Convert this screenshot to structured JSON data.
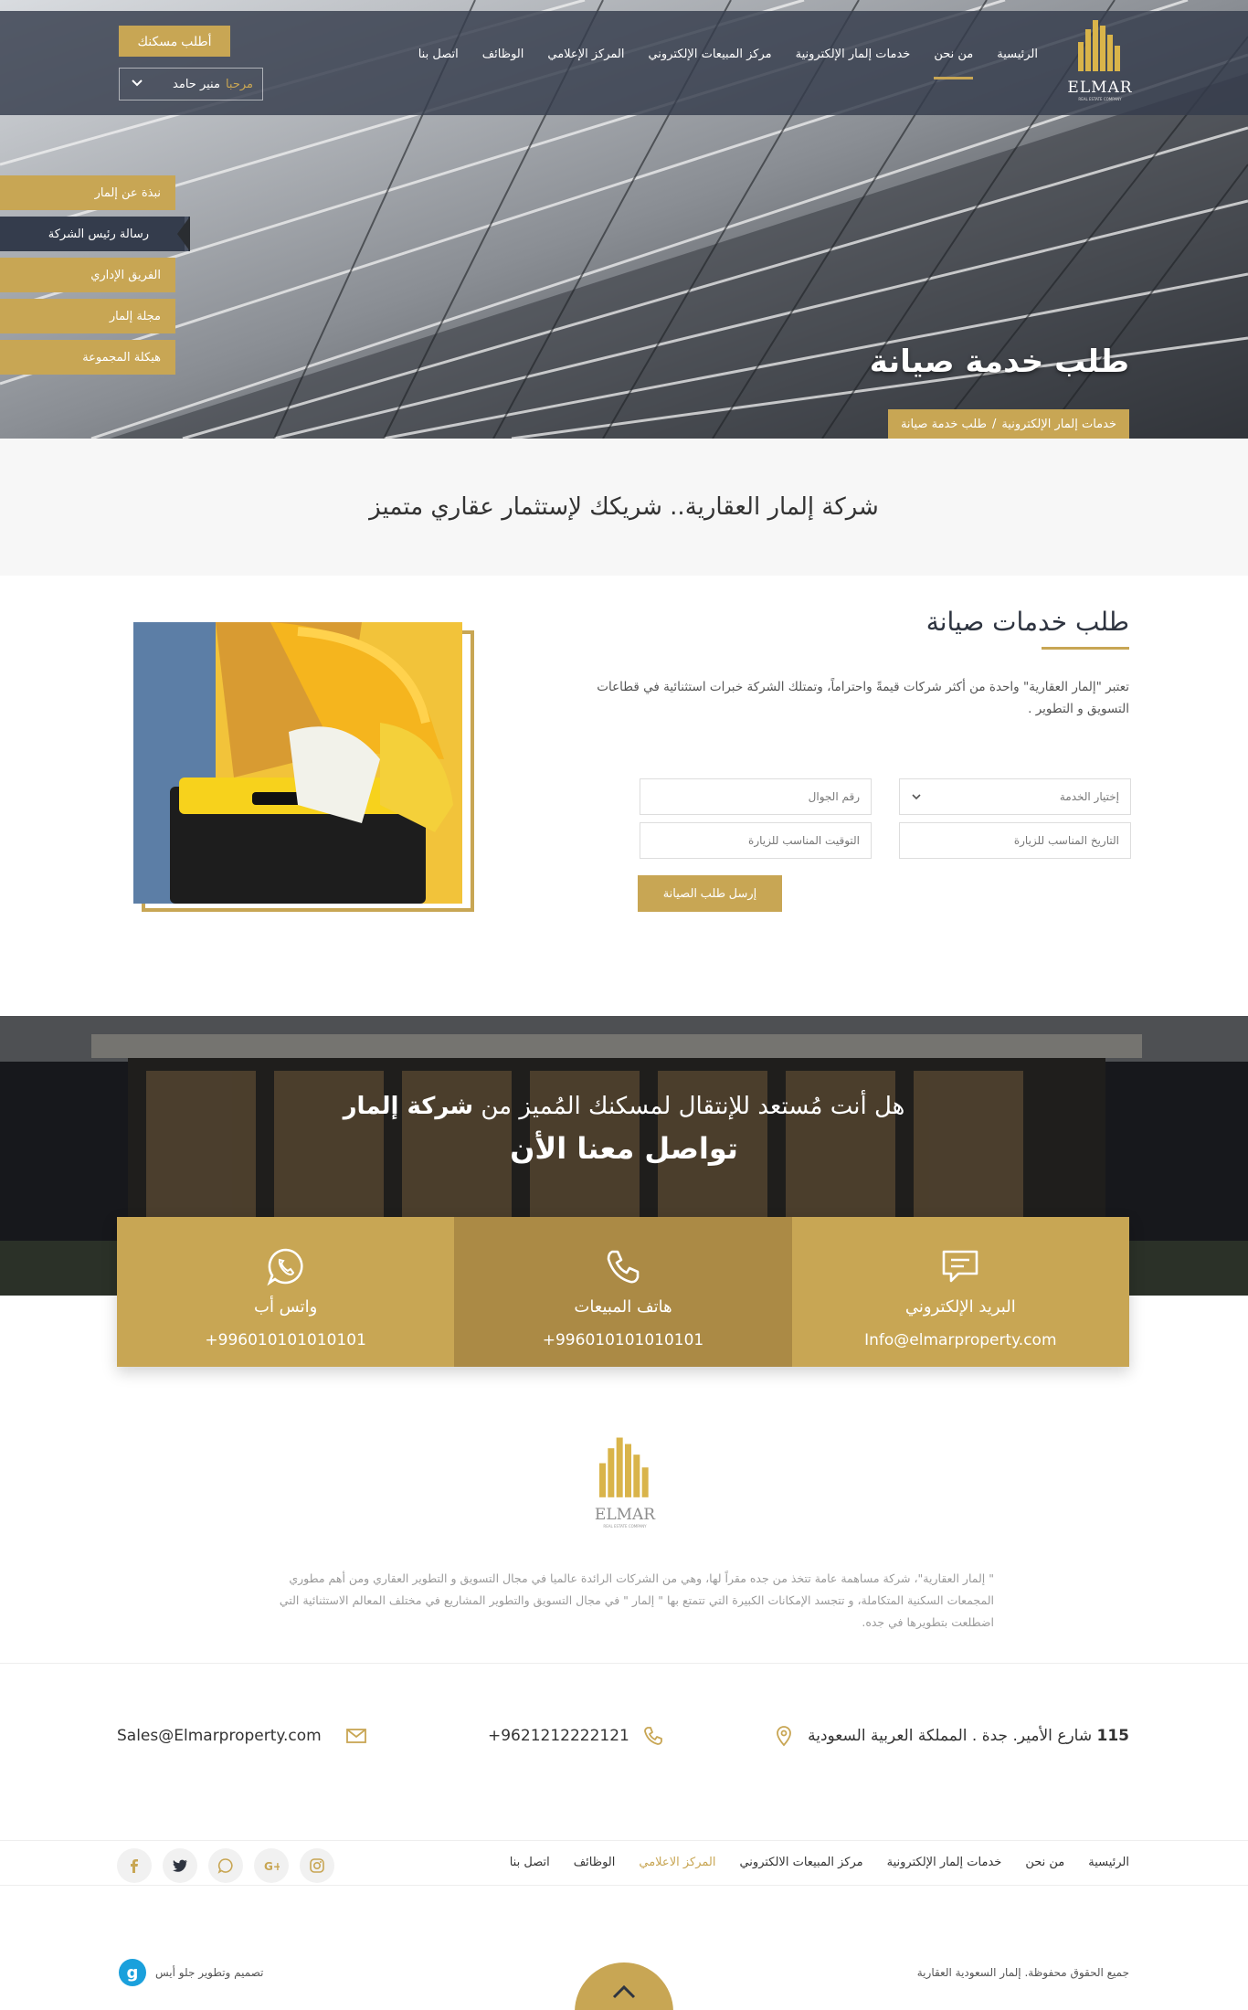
{
  "header": {
    "brand": "ELMAR",
    "brand_sub": "REAL ESTATE COMPANY",
    "nav": [
      "الرئيسية",
      "من نحن",
      "خدمات إلمار الإلكترونية",
      "مركز المبيعات الإلكتروني",
      "المركز الإعلامي",
      "الوظائف",
      "اتصل بنا"
    ],
    "request_home": "أطلب مسكنك",
    "greeting": "مرحبا",
    "user_name": "منير حامد"
  },
  "side_menu": [
    "نبذة عن إلمار",
    "رسالة رئيس الشركة",
    "الفريق الإداري",
    "مجلة إلمار",
    "هيكلة المجموعة"
  ],
  "hero": {
    "title": "طلب خدمة صيانة",
    "breadcrumb_parent": "خدمات إلمار الإلكترونية",
    "breadcrumb_sep": "/",
    "breadcrumb_current": "طلب خدمة صيانة"
  },
  "tagline": "شركة إلمار العقارية.. شريكك لإستثمار عقاري متميز",
  "service": {
    "title": "طلب خدمات صيانة",
    "description": "تعتبر \"إلمار العقارية\" واحدة من أكثر شركات قيمةً واحتراماً، وتمتلك الشركة خبرات استثنائية في قطاعات التسويق و التطوير .",
    "select_service": "إختيار الخدمة",
    "mobile_placeholder": "رقم الجوال",
    "date_placeholder": "التاريخ المناسب للزيارة",
    "time_placeholder": "التوقيت المناسب للزيارة",
    "submit": "إرسل طلب الصيانة"
  },
  "cta": {
    "line1_prefix": "هل أنت مُستعد للإنتقال لمسكنك المُميز من",
    "line1_brand": "شركة إلمار",
    "line2": "تواصل معنا الأن"
  },
  "contact_boxes": [
    {
      "title": "واتس أب",
      "value": "+996010101010101",
      "icon": "whatsapp-icon"
    },
    {
      "title": "هاتف المبيعات",
      "value": "+996010101010101",
      "icon": "phone-icon"
    },
    {
      "title": "البريد الإلكتروني",
      "value": "Info@elmarproperty.com",
      "icon": "chat-icon"
    }
  ],
  "about": "\" إلمار العقارية\"، شركة مساهمة عامة تتخذ من جده مقراً لها، وهي من الشركات الرائدة عالميا في مجال التسويق و التطوير العقاري ومن أهم مطوري المجمعات السكنية المتكاملة، و تتجسد الإمكانات الكبيرة التي تتمتع بها \" إلمار \" في مجال التسويق والتطوير المشاريع في مختلف المعالم الاستثنائية التي اضطلعت بتطويرها في جده.",
  "contact_info": {
    "address_num": "115",
    "address": "شارع الأمير. جدة . المملكة العربية السعودية",
    "phone": "+9621212222121",
    "email": "Sales@Elmarproperty.com"
  },
  "footer_nav": [
    "الرئيسية",
    "من نحن",
    "خدمات إلمار الإلكترونية",
    "مركز المبيعات الالكتروني",
    "المركز الاعلامي",
    "الوظائف",
    "اتصل بنا"
  ],
  "footer": {
    "copyright": "جميع الحقوق محفوظة. إلمار السعودية العقارية",
    "credit": "تصميم وتطوير جلو أيس",
    "credit_logo": "g"
  },
  "colors": {
    "gold": "#c8a654",
    "gold_dark": "#ab8a45",
    "navy": "#343c4c"
  }
}
